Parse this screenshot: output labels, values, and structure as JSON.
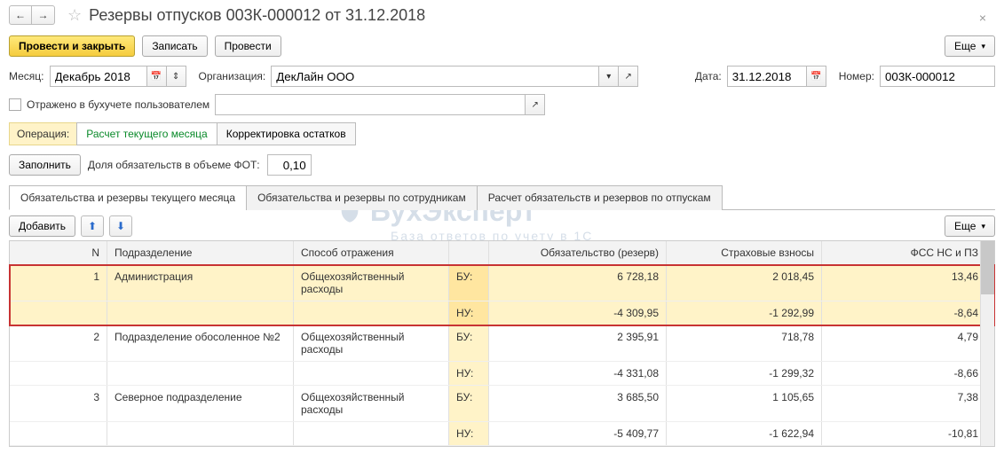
{
  "title": "Резервы отпусков  003К-000012 от 31.12.2018",
  "nav": {
    "back": "←",
    "fwd": "→"
  },
  "toolbar": {
    "post_close": "Провести и закрыть",
    "save": "Записать",
    "post": "Провести",
    "more": "Еще"
  },
  "form": {
    "month_label": "Месяц:",
    "month_value": "Декабрь 2018",
    "org_label": "Организация:",
    "org_value": "ДекЛайн ООО",
    "date_label": "Дата:",
    "date_value": "31.12.2018",
    "number_label": "Номер:",
    "number_value": "003К-000012",
    "reflected_label": "Отражено в бухучете пользователем"
  },
  "operation": {
    "label": "Операция:",
    "current": "Расчет текущего месяца",
    "correction": "Корректировка остатков"
  },
  "fill": {
    "button": "Заполнить",
    "ratio_label": "Доля обязательств в объеме ФОТ:",
    "ratio_value": "0,10"
  },
  "tabs": {
    "t1": "Обязательства и резервы текущего месяца",
    "t2": "Обязательства и резервы по сотрудникам",
    "t3": "Расчет обязательств и резервов по отпускам"
  },
  "grid_toolbar": {
    "add": "Добавить",
    "more": "Еще"
  },
  "grid_header": {
    "n": "N",
    "dept": "Подразделение",
    "method": "Способ отражения",
    "obl": "Обязательство (резерв)",
    "ins": "Страховые взносы",
    "fss": "ФСС НС и ПЗ"
  },
  "acc_types": {
    "bu": "БУ:",
    "nu": "НУ:"
  },
  "rows": [
    {
      "n": "1",
      "dept": "Администрация",
      "method": "Общехозяйственный расходы",
      "bu": {
        "obl": "6 728,18",
        "ins": "2 018,45",
        "fss": "13,46"
      },
      "nu": {
        "obl": "-4 309,95",
        "ins": "-1 292,99",
        "fss": "-8,64"
      }
    },
    {
      "n": "2",
      "dept": "Подразделение обосоленное №2",
      "method": "Общехозяйственный расходы",
      "bu": {
        "obl": "2 395,91",
        "ins": "718,78",
        "fss": "4,79"
      },
      "nu": {
        "obl": "-4 331,08",
        "ins": "-1 299,32",
        "fss": "-8,66"
      }
    },
    {
      "n": "3",
      "dept": "Северное подразделение",
      "method": "Общехозяйственный расходы",
      "bu": {
        "obl": "3 685,50",
        "ins": "1 105,65",
        "fss": "7,38"
      },
      "nu": {
        "obl": "-5 409,77",
        "ins": "-1 622,94",
        "fss": "-10,81"
      }
    }
  ],
  "watermark": {
    "main": "БухЭксперт",
    "sub": "База ответов по учету в 1С"
  }
}
